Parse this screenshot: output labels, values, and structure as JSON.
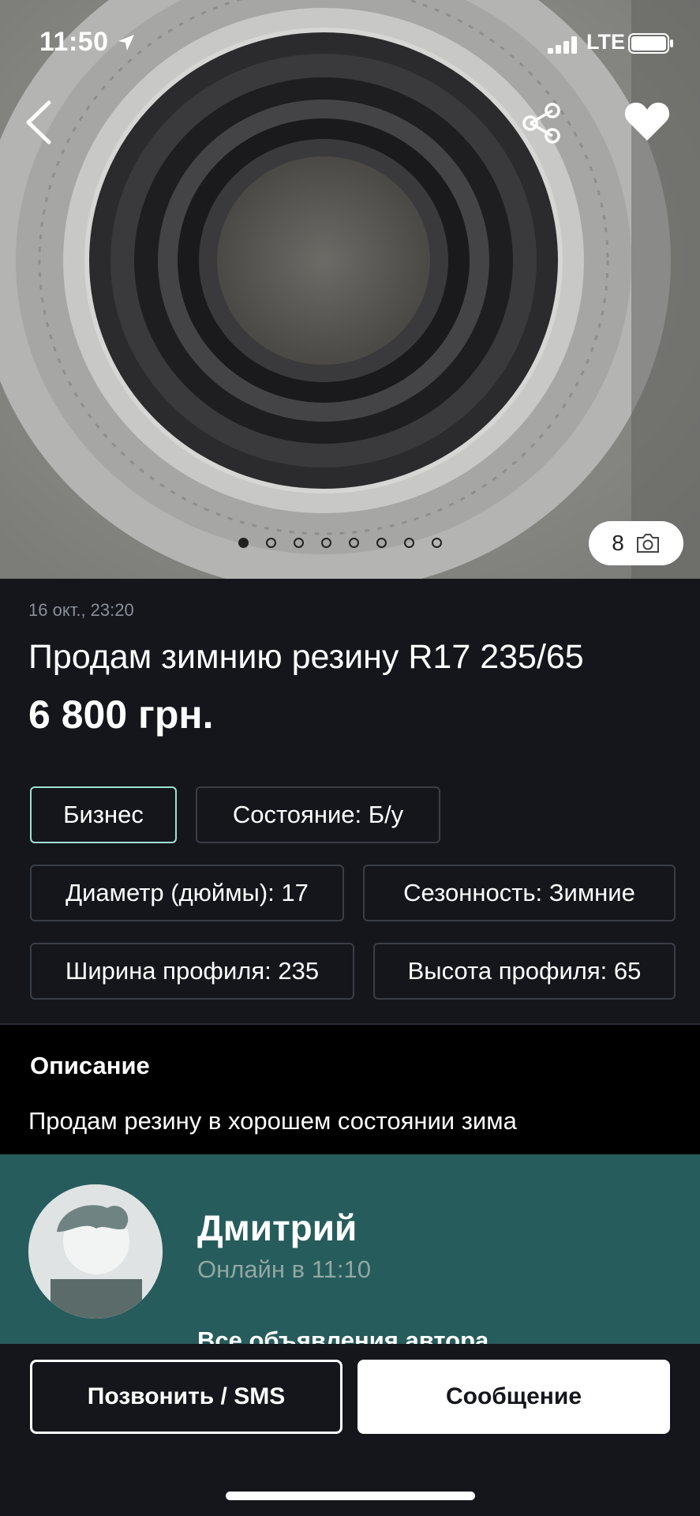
{
  "status_bar": {
    "time": "11:50",
    "network": "LTE"
  },
  "gallery": {
    "photo_count": "8",
    "total_dots": 8,
    "active_dot": 1
  },
  "listing": {
    "date": "16 окт., 23:20",
    "title": "Продам зимнию резину R17 235/65",
    "price": "6 800 грн."
  },
  "tags": {
    "business": "Бизнес",
    "condition": "Состояние: Б/у",
    "diameter": "Диаметр (дюймы): 17",
    "season": "Сезонность: Зимние",
    "width": "Ширина профиля: 235",
    "height": "Высота профиля: 65"
  },
  "description": {
    "heading": "Описание",
    "text": "Продам резину в хорошем состоянии зима"
  },
  "seller": {
    "name": "Дмитрий",
    "online": "Онлайн в 11:10",
    "all_ads": "Все объявления автора"
  },
  "actions": {
    "call": "Позвонить / SMS",
    "message": "Сообщение"
  },
  "colors": {
    "accent": "#9fe1d4",
    "seller_bg": "#275c5c",
    "page_bg": "#14161c"
  },
  "icons": [
    "back-arrow-icon",
    "share-icon",
    "heart-icon",
    "camera-icon",
    "location-arrow-icon",
    "signal-icon",
    "battery-icon"
  ]
}
